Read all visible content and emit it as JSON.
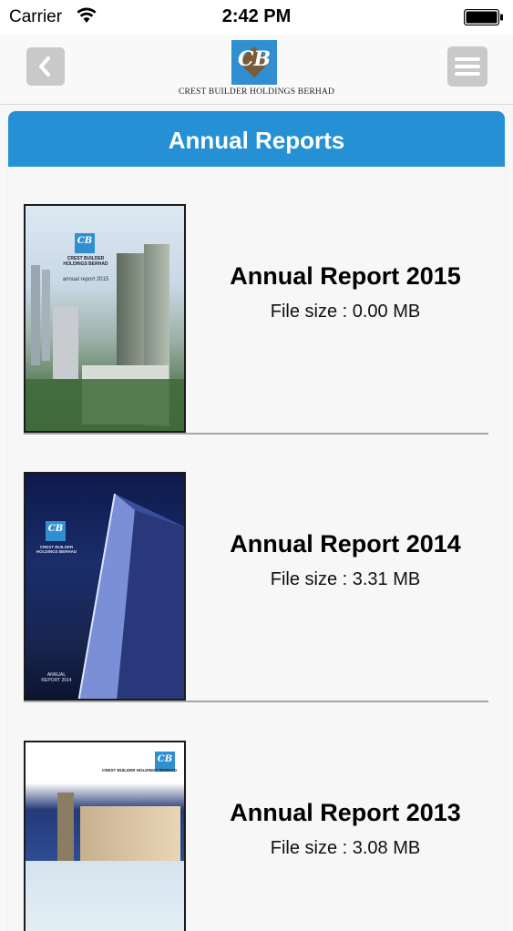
{
  "status_bar": {
    "carrier": "Carrier",
    "time": "2:42 PM"
  },
  "nav": {
    "back_icon": "chevron-left-icon",
    "menu_icon": "hamburger-menu-icon",
    "logo_letters": "CB",
    "company_name": "CREST BUILDER HOLDINGS BERHAD"
  },
  "page": {
    "title": "Annual Reports"
  },
  "colors": {
    "header_blue": "#2590d4",
    "button_gray": "#c9c9c9",
    "logo_blue": "#2f8fd0"
  },
  "reports": [
    {
      "title": "Annual Report 2015",
      "file_size": "File size : 0.00 MB",
      "cover_text": [
        "CREST BUILDER HOLDINGS BERHAD",
        "annual report 2015"
      ]
    },
    {
      "title": "Annual Report 2014",
      "file_size": "File size : 3.31 MB",
      "cover_text": [
        "CREST BUILDER HOLDINGS BERHAD",
        "ANNUAL REPORT 2014"
      ]
    },
    {
      "title": "Annual Report 2013",
      "file_size": "File size : 3.08 MB",
      "cover_text": [
        "CREST BUILDER HOLDINGS BERHAD"
      ]
    }
  ]
}
